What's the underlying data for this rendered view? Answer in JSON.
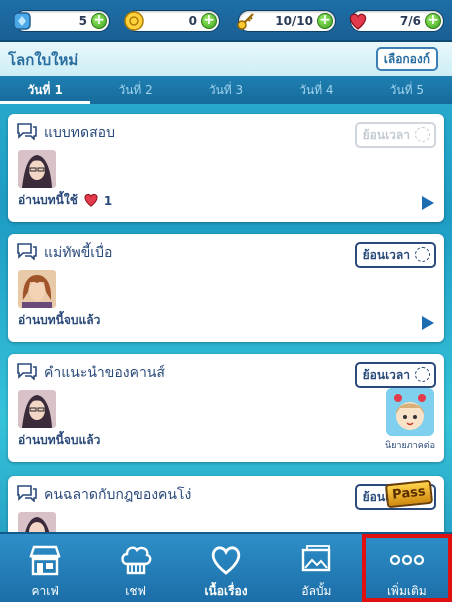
{
  "resources": [
    {
      "icon": "gem-icon",
      "value": "5"
    },
    {
      "icon": "coin-icon",
      "value": "0"
    },
    {
      "icon": "key-icon",
      "value": "10/10"
    },
    {
      "icon": "heart-icon",
      "value": "7/6"
    }
  ],
  "header": {
    "title": "โลกใบใหม่",
    "select_label": "เลือกองก์"
  },
  "tabs": [
    "วันที่ 1",
    "วันที่ 2",
    "วันที่ 3",
    "วันที่ 4",
    "วันที่ 5"
  ],
  "episodes": [
    {
      "title": "แบบทดสอบ",
      "rewind": "ย้อนเวลา",
      "status": "อ่านบทนี้ใช้",
      "cost": "1"
    },
    {
      "title": "แม่ทัพขี้เบื่อ",
      "rewind": "ย้อนเวลา",
      "status": "อ่านบทนี้จบแล้ว"
    },
    {
      "title": "คำแนะนำของคานส์",
      "rewind": "ย้อนเวลา",
      "status": "อ่านบทนี้จบแล้ว"
    },
    {
      "title": "คนฉลาดกับกฎของคนโง่",
      "rewind": "ย้อนเวลา"
    }
  ],
  "promo": {
    "label": "นิยายภาคต่อ"
  },
  "pass_label": "Pass",
  "nav": [
    {
      "icon": "cafe-icon",
      "label": "คาเฟ่"
    },
    {
      "icon": "chef-hat-icon",
      "label": "เชฟ"
    },
    {
      "icon": "heart-outline-icon",
      "label": "เนื้อเรื่อง"
    },
    {
      "icon": "album-icon",
      "label": "อัลบั้ม"
    },
    {
      "icon": "more-icon",
      "label": "เพิ่มเติม"
    }
  ],
  "colors": {
    "accent": "#1e6db0",
    "highlight": "#e01010",
    "heart": "#e23a4a"
  }
}
